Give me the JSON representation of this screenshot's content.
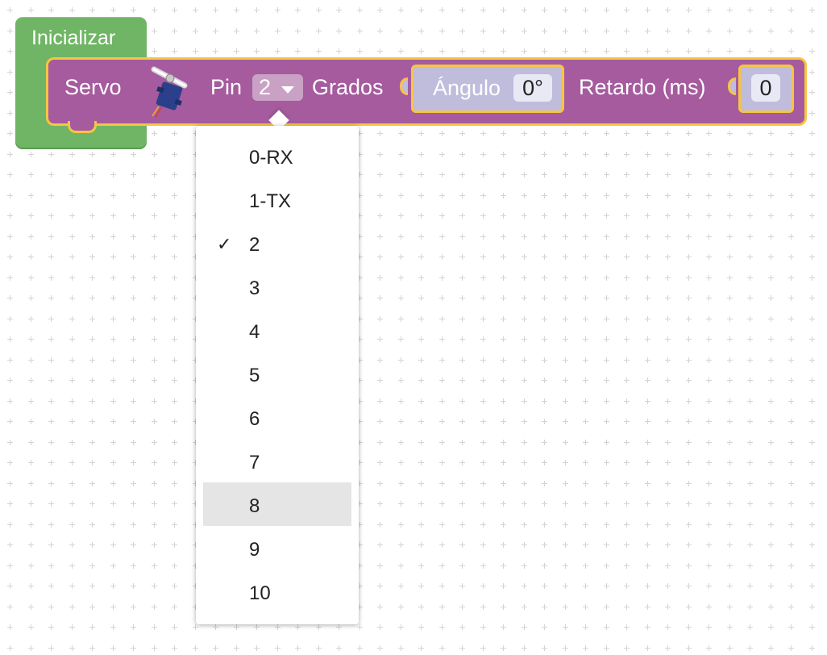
{
  "init_block": {
    "title": "Inicializar",
    "color": "#6fb565"
  },
  "servo_block": {
    "color": "#a55b9e",
    "border_color": "#f6c544",
    "label": "Servo",
    "icon": "servo-motor-icon",
    "pin_label": "Pin",
    "pin_value": "2",
    "grados_label": "Grados",
    "angle_block_label": "Ángulo",
    "angle_value": "0°",
    "delay_label": "Retardo (ms)",
    "delay_value": "0"
  },
  "pin_menu": {
    "selected": "2",
    "highlighted": "8",
    "items": [
      "0-RX",
      "1-TX",
      "2",
      "3",
      "4",
      "5",
      "6",
      "7",
      "8",
      "9",
      "10"
    ],
    "check_glyph": "✓"
  }
}
